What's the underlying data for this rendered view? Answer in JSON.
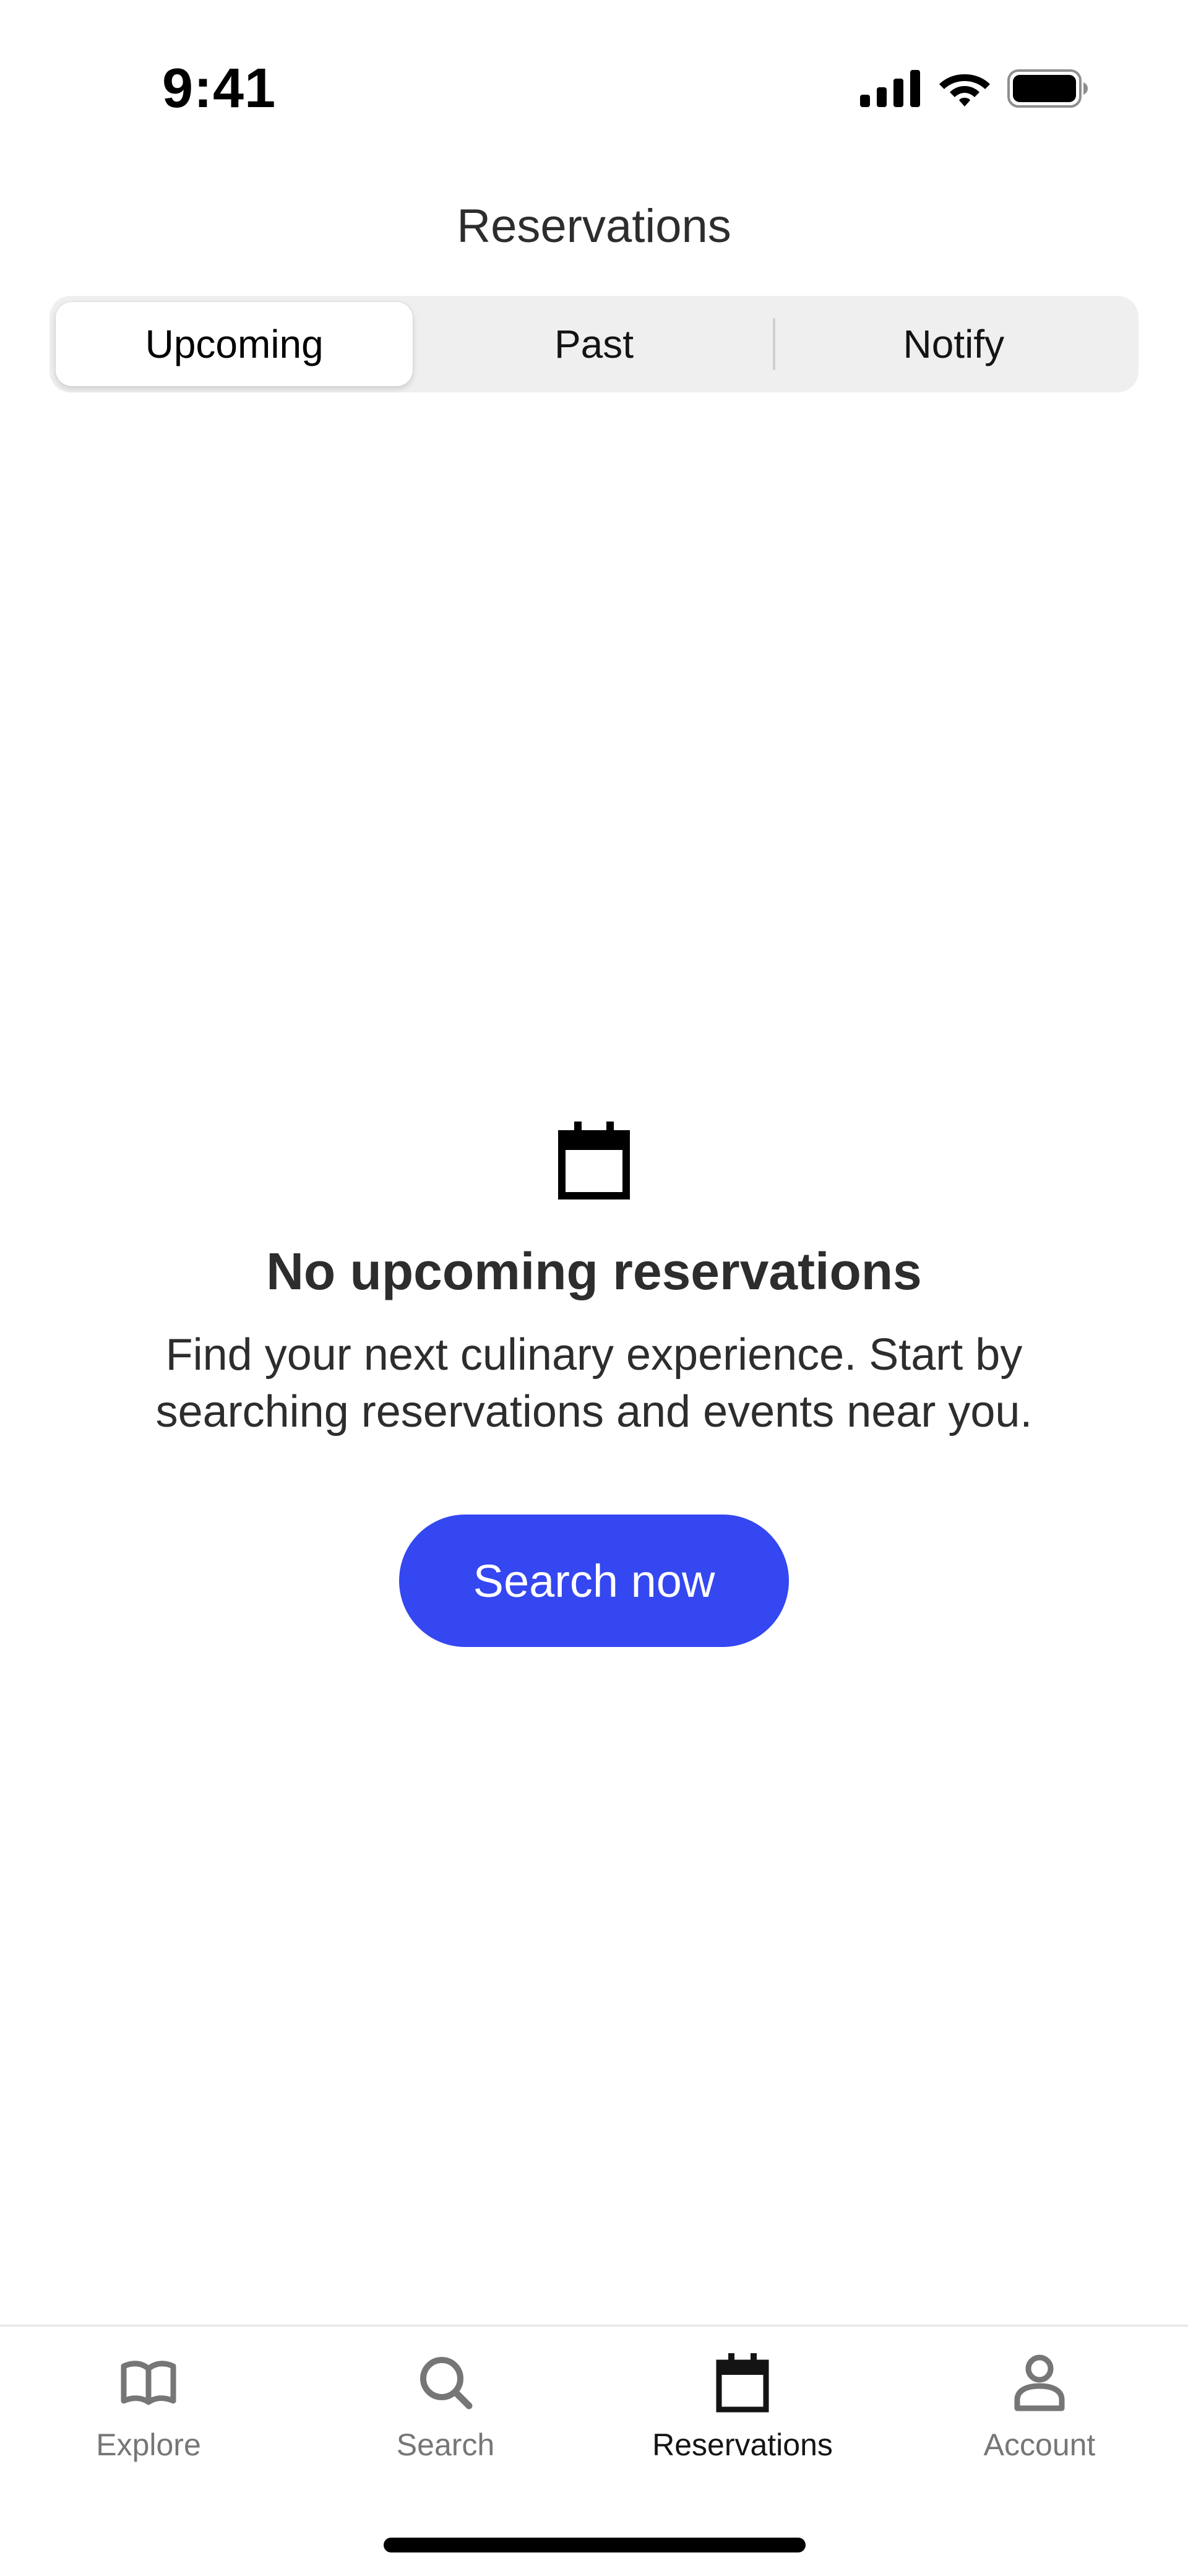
{
  "status_bar": {
    "time": "9:41",
    "icons": [
      "cellular-signal-icon",
      "wifi-icon",
      "battery-icon"
    ]
  },
  "header": {
    "title": "Reservations"
  },
  "segmented_control": {
    "selected": "Upcoming",
    "items": [
      {
        "label": "Upcoming"
      },
      {
        "label": "Past"
      },
      {
        "label": "Notify"
      }
    ]
  },
  "empty_state": {
    "icon": "calendar-icon",
    "title": "No upcoming reservations",
    "body": "Find your next culinary experience. Start by searching reservations and events near you.",
    "button_label": "Search now"
  },
  "tab_bar": {
    "selected": "Reservations",
    "items": [
      {
        "label": "Explore",
        "icon": "book-icon"
      },
      {
        "label": "Search",
        "icon": "search-icon"
      },
      {
        "label": "Reservations",
        "icon": "calendar-icon"
      },
      {
        "label": "Account",
        "icon": "person-icon"
      }
    ]
  },
  "colors": {
    "accent": "#3447f0",
    "tab_active": "#141414",
    "tab_inactive": "#767676",
    "segment_background": "#efefef"
  }
}
